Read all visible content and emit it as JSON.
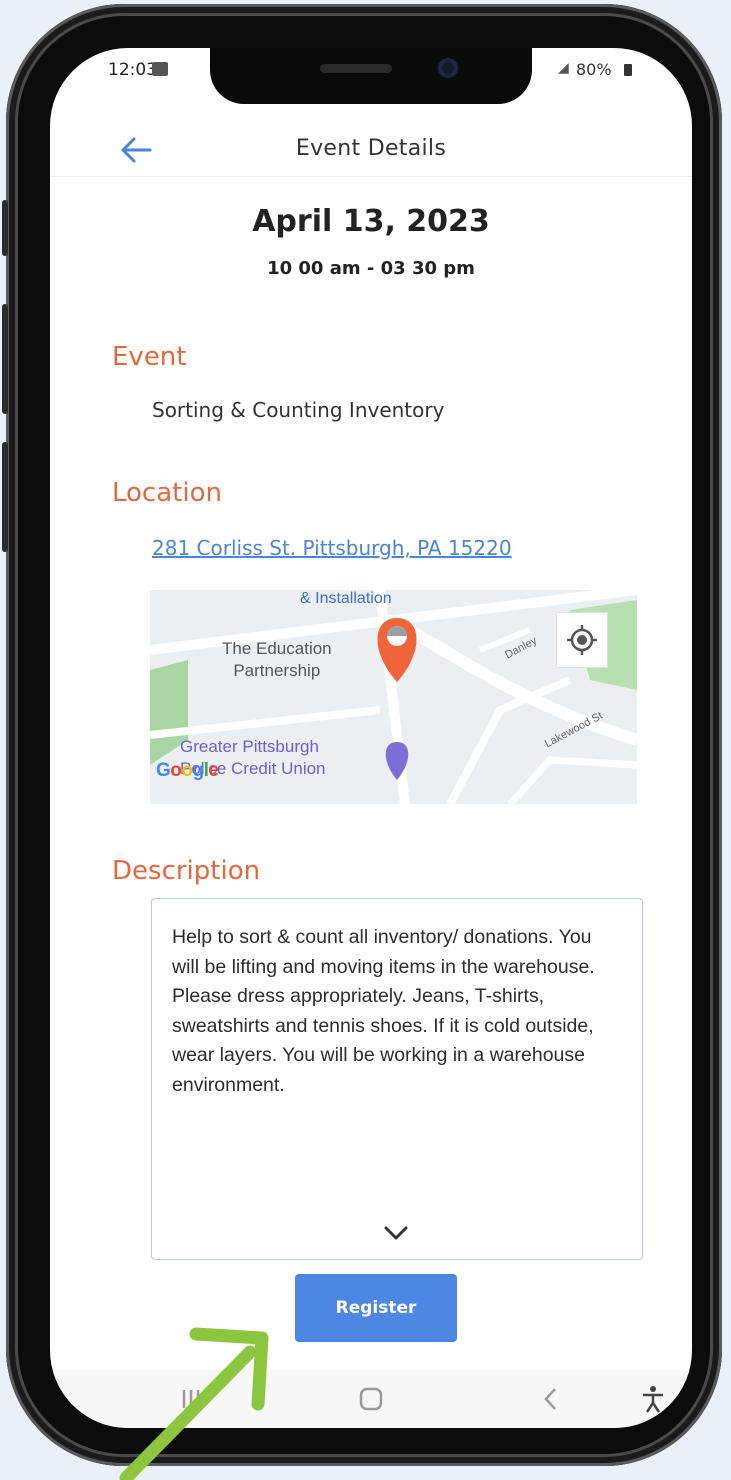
{
  "status_bar": {
    "time": "12:03",
    "battery": "80%"
  },
  "header": {
    "title": "Event Details"
  },
  "event": {
    "date": "April 13, 2023",
    "time": "10 00 am - 03 30 pm",
    "event_heading": "Event",
    "event_name": "Sorting & Counting Inventory",
    "location_heading": "Location",
    "address": "281 Corliss St.  Pittsburgh, PA  15220",
    "description_heading": "Description",
    "description": "Help to sort & count all inventory/ donations. You will be lifting and moving items in the warehouse. Please dress appropriately. Jeans, T-shirts, sweatshirts and tennis shoes. If it is cold outside, wear layers. You will be working in a warehouse environment."
  },
  "map": {
    "label_top": "& Installation",
    "poi_1": "The Education\nPartnership",
    "poi_2": "Greater Pittsburgh\nPolice Credit Union",
    "street_1": "Danley",
    "street_2": "Lakewood St",
    "logo": "Google",
    "pin_color": "#f0643a"
  },
  "actions": {
    "register_label": "Register"
  },
  "colors": {
    "accent": "#e06a3f",
    "link": "#4a86d8",
    "button": "#4e86e4",
    "annotation": "#8cc63f"
  }
}
